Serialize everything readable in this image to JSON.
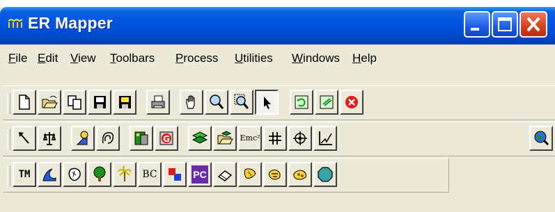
{
  "window": {
    "title": "ER Mapper",
    "app_icon": "er-mapper-logo-icon",
    "controls": [
      "minimize-icon",
      "maximize-icon",
      "close-icon"
    ]
  },
  "menubar": {
    "items": [
      {
        "label": "File",
        "accesskey": "F"
      },
      {
        "label": "Edit",
        "accesskey": "E"
      },
      {
        "label": "View",
        "accesskey": "V"
      },
      {
        "label": "Toolbars",
        "accesskey": "T"
      },
      {
        "label": "Process",
        "accesskey": "P"
      },
      {
        "label": "Utilities",
        "accesskey": "U"
      },
      {
        "label": "Windows",
        "accesskey": "W"
      },
      {
        "label": "Help",
        "accesskey": "H"
      }
    ]
  },
  "toolbar1": {
    "buttons": [
      "new-file-icon",
      "open-folder-icon",
      "copy-icon",
      "save-icon",
      "save-as-icon",
      "print-icon",
      "hand-pan-icon",
      "zoom-icon",
      "zoom-box-icon",
      "pointer-icon",
      "refresh-icon",
      "refresh-all-icon",
      "stop-icon"
    ]
  },
  "toolbar2": {
    "buttons": [
      "line-pointer-icon",
      "scale-icon",
      "shape-icon",
      "contour-icon",
      "layers-icon",
      "gamma-icon",
      "algorithm-icon",
      "open-layers-icon",
      "formula-icon",
      "grid-icon",
      "target-icon",
      "histogram-icon",
      "globe-search-icon"
    ],
    "formula_text": "Emc²"
  },
  "toolbar3": {
    "buttons": [
      "tm-icon",
      "wave-icon",
      "blob-icon",
      "tree-icon",
      "palm-icon",
      "bc-icon",
      "squares-icon",
      "pc-icon",
      "eraser-icon",
      "gradient-shape-icon",
      "gradient-shape-2-icon",
      "gradient-shape-3-icon",
      "octagon-icon"
    ],
    "tm_text": "TM",
    "bc_text": "BC",
    "pc_text": "PC"
  }
}
